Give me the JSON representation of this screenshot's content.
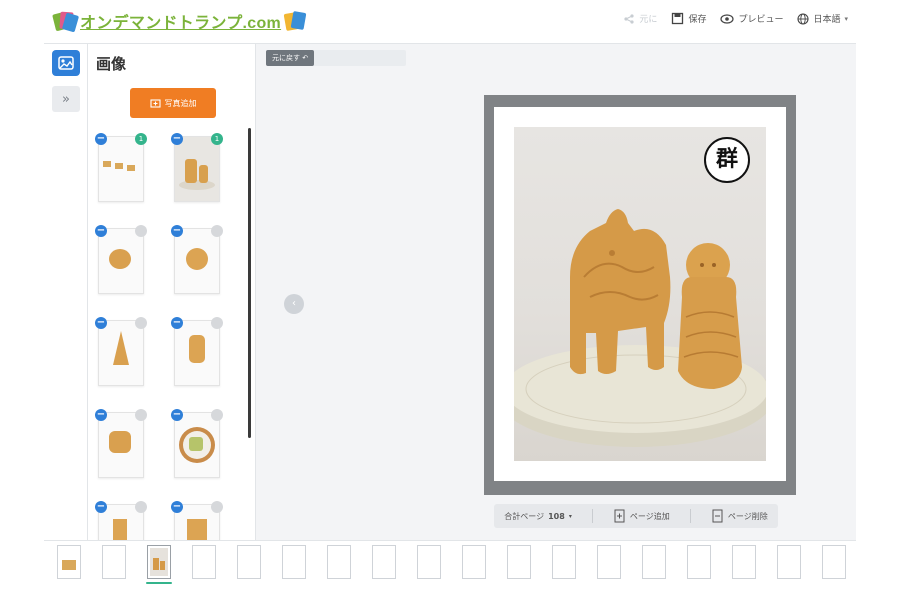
{
  "app": {
    "logo_text": "オンデマンドトランプ.com"
  },
  "header": {
    "tools": [
      {
        "label": "元に",
        "icon": "share-icon",
        "disabled": true
      },
      {
        "label": "保存",
        "icon": "save-icon",
        "disabled": false
      },
      {
        "label": "プレビュー",
        "icon": "eye-icon",
        "disabled": false
      },
      {
        "label": "日本語",
        "icon": "globe-icon",
        "disabled": false
      }
    ]
  },
  "rail": {
    "image_button_icon": "image-icon",
    "expand_label": "»"
  },
  "panel": {
    "title": "画像",
    "upload_label": "写真追加"
  },
  "toolbar": {
    "undo_label": "元に戻す ↶"
  },
  "card": {
    "badge_text": "群",
    "image_subject": "horse-and-figure-sweets-photo"
  },
  "page_controls": {
    "page_label": "合計ページ",
    "page_count": "108",
    "add_label": "ページ追加",
    "delete_label": "ページ削除"
  },
  "filmstrip": {
    "count": 18,
    "active_index": 2
  },
  "colors": {
    "accent_blue": "#2f7fd8",
    "upload_orange": "#f07d23",
    "badge_green": "#34b48c",
    "frame_gray": "#808386"
  }
}
